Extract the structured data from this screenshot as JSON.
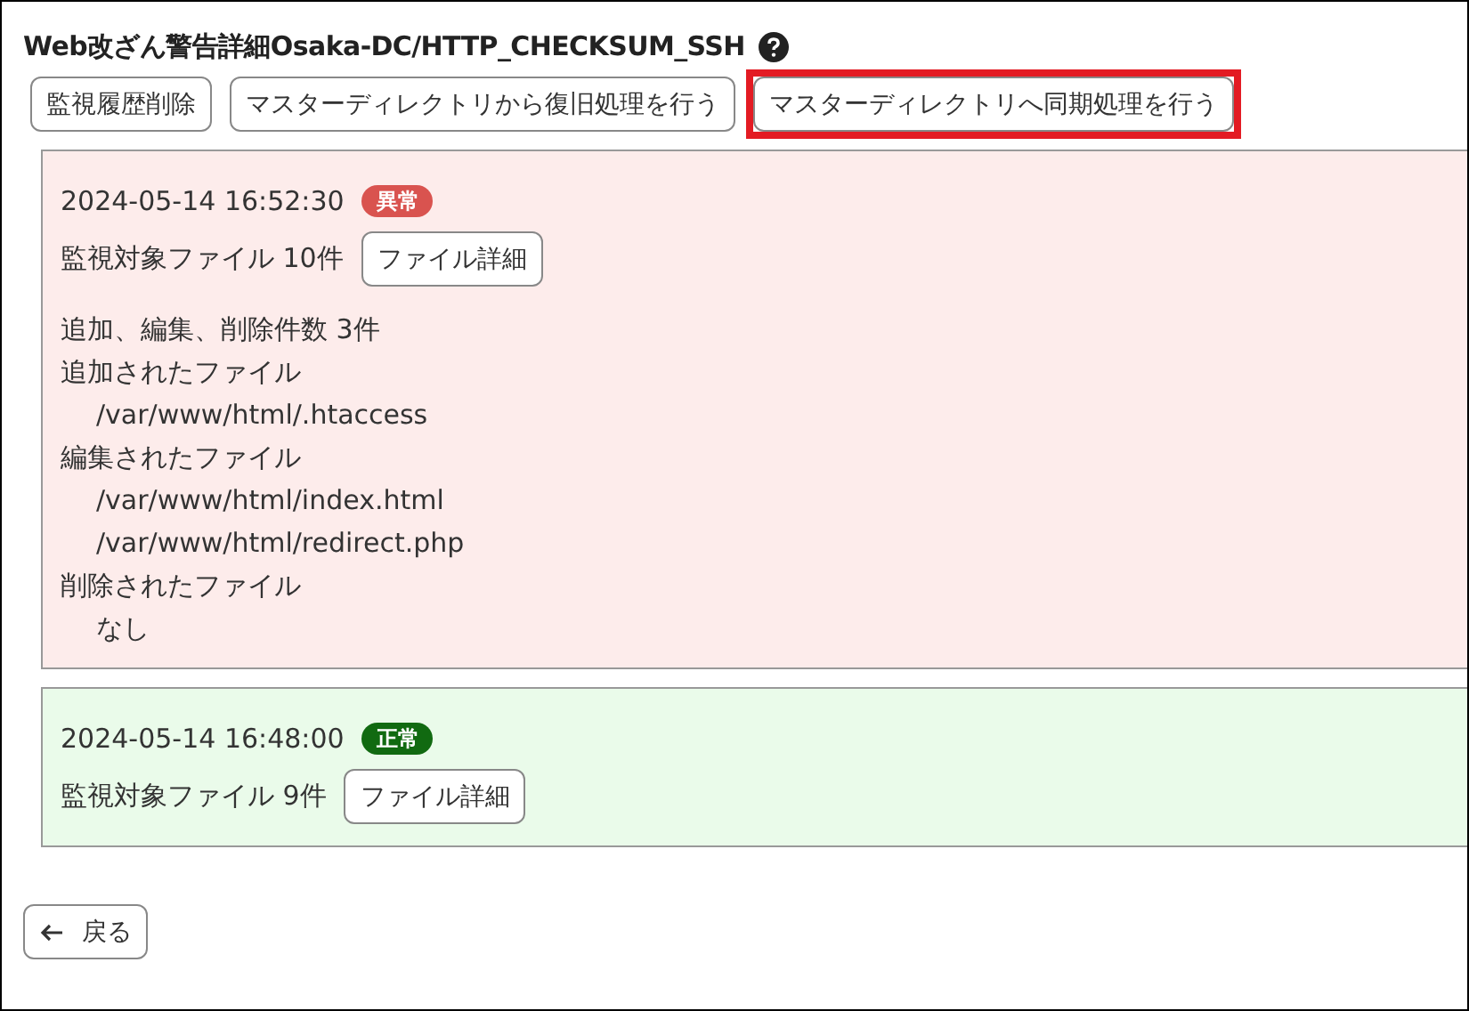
{
  "title": "Web改ざん警告詳細Osaka-DC/HTTP_CHECKSUM_SSH",
  "actions": [
    {
      "label": "監視履歴削除",
      "highlighted": false
    },
    {
      "label": "マスターディレクトリから復旧処理を行う",
      "highlighted": false
    },
    {
      "label": "マスターディレクトリへ同期処理を行う",
      "highlighted": true
    }
  ],
  "records": [
    {
      "timestamp": "2024-05-14 16:52:30",
      "status": {
        "label": "異常",
        "kind": "error"
      },
      "file_count": "監視対象ファイル 10件",
      "detail_button": "ファイル詳細",
      "summary": "追加、編集、削除件数 3件",
      "groups": [
        {
          "heading": "追加されたファイル",
          "files": [
            "/var/www/html/.htaccess"
          ]
        },
        {
          "heading": "編集されたファイル",
          "files": [
            "/var/www/html/index.html",
            "/var/www/html/redirect.php"
          ]
        },
        {
          "heading": "削除されたファイル",
          "files": [
            "なし"
          ]
        }
      ]
    },
    {
      "timestamp": "2024-05-14 16:48:00",
      "status": {
        "label": "正常",
        "kind": "ok"
      },
      "file_count": "監視対象ファイル 9件",
      "detail_button": "ファイル詳細"
    }
  ],
  "back_button": "戻る"
}
